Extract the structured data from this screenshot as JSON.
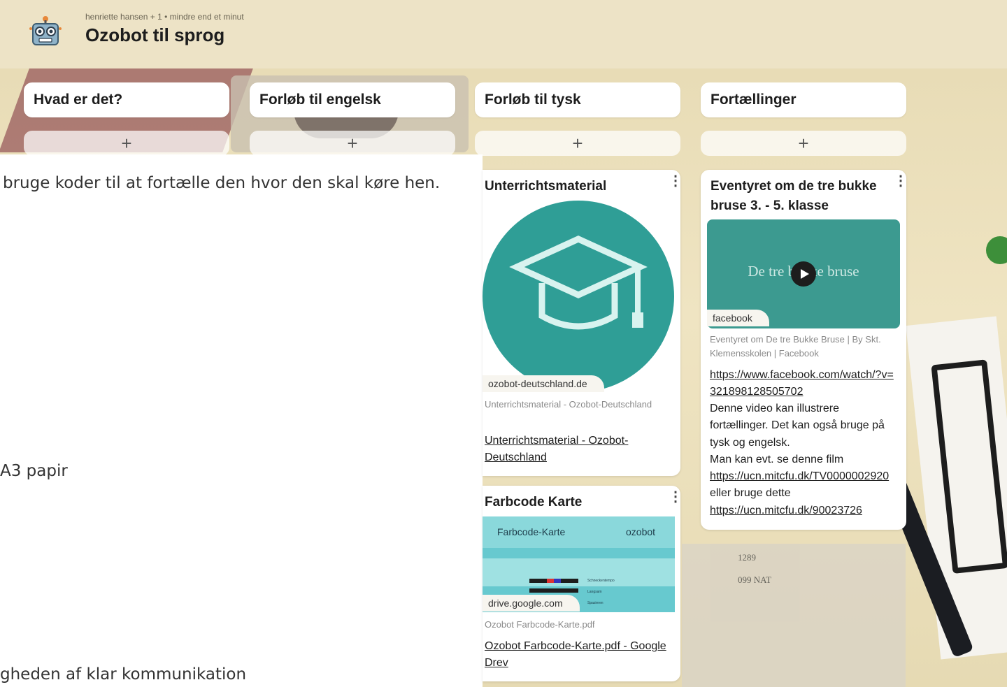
{
  "header": {
    "meta": "henriette hansen  + 1  • mindre end et minut",
    "title": "Ozobot til sprog"
  },
  "columns": [
    {
      "title": "Hvad er det?",
      "add": "+"
    },
    {
      "title": "Forløb til engelsk",
      "add": "+"
    },
    {
      "title": "Forløb til tysk",
      "add": "+"
    },
    {
      "title": "Fortællinger",
      "add": "+"
    }
  ],
  "overlay_text": {
    "line1": "bruge koder til at fortælle den hvor den skal køre hen.",
    "line2": "A3 papir",
    "line3": "gheden af klar kommunikation"
  },
  "cards": {
    "unterricht": {
      "title": "Unterrichtsmaterial",
      "menu": "⋮",
      "source": "ozobot-deutschland.de",
      "sub": "Unterrichtsmaterial - Ozobot-Deutschland",
      "link": "Unterrichtsmaterial - Ozobot-Deutschland"
    },
    "farbcode": {
      "title": "Farbcode Karte",
      "menu": "⋮",
      "thumb_heading": "Farbcode-Karte",
      "thumb_brand": "ozobot",
      "thumb_rows": [
        "Schneckentempo",
        "Langsam",
        "Spazieren"
      ],
      "source": "drive.google.com",
      "sub": "Ozobot Farbcode-Karte.pdf",
      "link": "Ozobot Farbcode-Karte.pdf - Google Drev"
    },
    "eventyret": {
      "title": "Eventyret om de tre bukke bruse 3. - 5. klasse",
      "menu": "⋮",
      "thumb_text": "De tre bukke bruse",
      "source": "facebook",
      "sub": "Eventyret om De tre Bukke Bruse | By Skt. Klemensskolen | Facebook",
      "link": "https://www.facebook.com/watch/?v=321898128505702",
      "body1": "Denne video kan illustrere fortællinger. Det kan også bruge på tysk og engelsk.",
      "body2": "Man kan evt. se denne film",
      "body_link1": "https://ucn.mitcfu.dk/TV0000002920",
      "body3": "eller bruge dette",
      "body_link2": "https://ucn.mitcfu.dk/90023726"
    }
  },
  "photo_labels": {
    "a": "1289",
    "b": "099 NAT"
  },
  "colors": {
    "board_bg": "#ede3c6",
    "teal": "#2f9e96",
    "card": "#ffffff"
  }
}
